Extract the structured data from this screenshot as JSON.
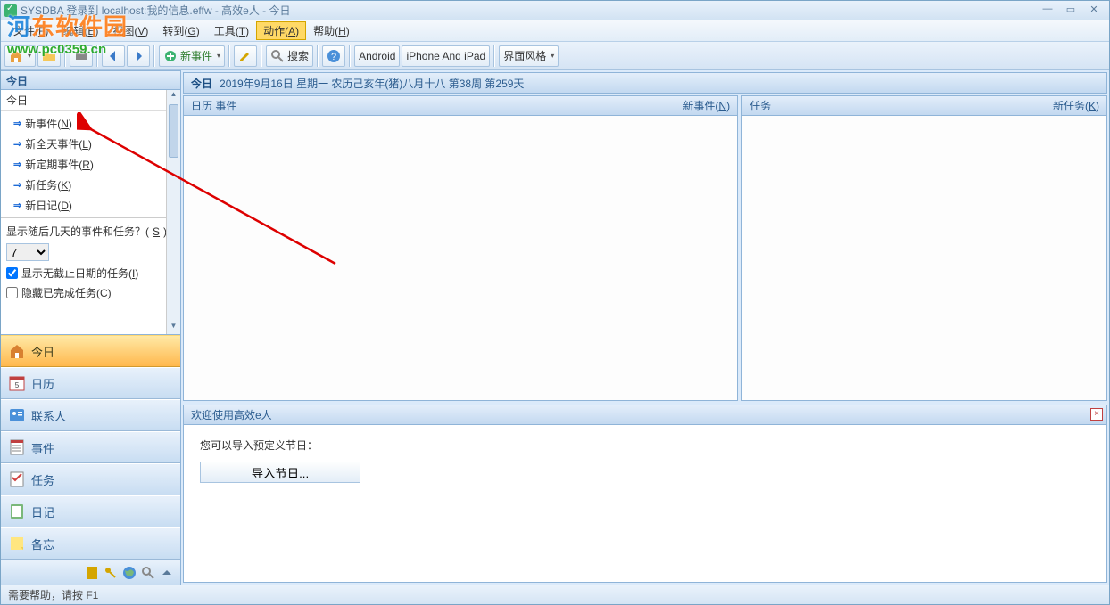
{
  "title": "SYSDBA 登录到 localhost:我的信息.effw - 高效e人 - 今日",
  "watermark": {
    "brand_a": "河",
    "brand_b": "东软件园",
    "url": "www.pc0359.cn"
  },
  "menu": {
    "file": "文件(F)",
    "edit": "编辑(E)",
    "view": "视图(V)",
    "goto": "转到(G)",
    "tools": "工具(T)",
    "action": "动作(A)",
    "help": "帮助(H)"
  },
  "toolbar": {
    "new": "新事件",
    "search": "搜索",
    "android": "Android",
    "ipad": "iPhone And iPad",
    "style": "界面风格"
  },
  "sidebar": {
    "head": "今日",
    "subhead": "今日",
    "actions": [
      {
        "label": "新事件(N)"
      },
      {
        "label": "新全天事件(L)"
      },
      {
        "label": "新定期事件(R)"
      },
      {
        "label": "新任务(K)"
      },
      {
        "label": "新日记(D)"
      }
    ],
    "opt_days_label": "显示随后几天的事件和任务？(S)",
    "opt_days_value": "7",
    "opt_nodate": "显示无截止日期的任务(I)",
    "opt_hidedone": "隐藏已完成任务(C)",
    "nav": [
      {
        "label": "今日"
      },
      {
        "label": "日历"
      },
      {
        "label": "联系人"
      },
      {
        "label": "事件"
      },
      {
        "label": "任务"
      },
      {
        "label": "日记"
      },
      {
        "label": "备忘"
      }
    ]
  },
  "date": {
    "today": "今日",
    "full": "2019年9月16日 星期一 农历己亥年(猪)八月十八  第38周 第259天"
  },
  "panels": {
    "cal_title": "日历  事件",
    "cal_new": "新事件(N)",
    "task_title": "任务",
    "task_new": "新任务(K)"
  },
  "welcome": {
    "title": "欢迎使用高效e人",
    "text": "您可以导入预定义节日：",
    "btn": "导入节日..."
  },
  "status": "需要帮助，请按 F1"
}
